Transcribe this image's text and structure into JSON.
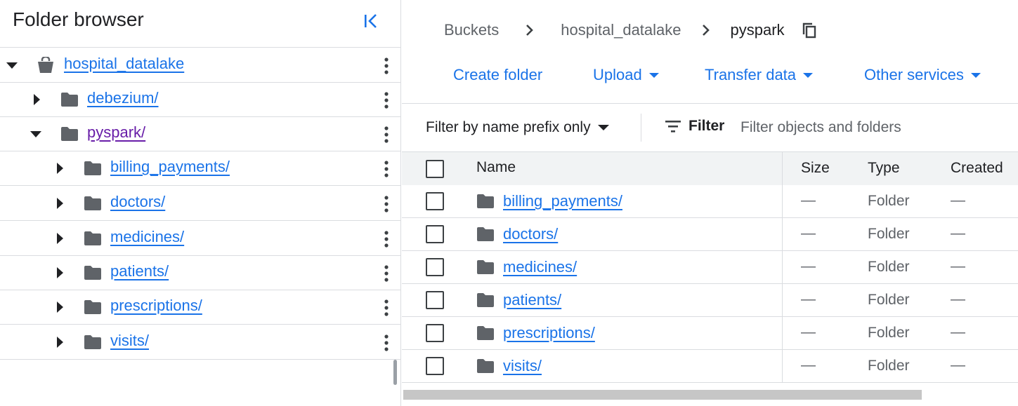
{
  "sidebar": {
    "title": "Folder browser",
    "collapse_icon": "collapse-left-icon",
    "bucket": {
      "label": "hospital_datalake",
      "icon": "bucket-icon",
      "expanded": true
    },
    "items": [
      {
        "label": "debezium/",
        "level": 1,
        "expanded": false,
        "visited": false
      },
      {
        "label": "pyspark/",
        "level": 1,
        "expanded": true,
        "visited": true
      },
      {
        "label": "billing_payments/",
        "level": 2,
        "expanded": false,
        "visited": false
      },
      {
        "label": "doctors/",
        "level": 2,
        "expanded": false,
        "visited": false
      },
      {
        "label": "medicines/",
        "level": 2,
        "expanded": false,
        "visited": false
      },
      {
        "label": "patients/",
        "level": 2,
        "expanded": false,
        "visited": false
      },
      {
        "label": "prescriptions/",
        "level": 2,
        "expanded": false,
        "visited": false
      },
      {
        "label": "visits/",
        "level": 2,
        "expanded": false,
        "visited": false
      }
    ]
  },
  "breadcrumb": {
    "items": [
      "Buckets",
      "hospital_datalake",
      "pyspark"
    ],
    "copy_icon": "copy-icon"
  },
  "actions": {
    "create_folder": "Create folder",
    "upload": "Upload",
    "transfer_data": "Transfer data",
    "other_services": "Other services"
  },
  "filter": {
    "mode": "Filter by name prefix only",
    "button": "Filter",
    "placeholder": "Filter objects and folders"
  },
  "table": {
    "columns": [
      "Name",
      "Size",
      "Type",
      "Created"
    ],
    "rows": [
      {
        "name": "billing_payments/",
        "size": "—",
        "type": "Folder",
        "created": "—"
      },
      {
        "name": "doctors/",
        "size": "—",
        "type": "Folder",
        "created": "—"
      },
      {
        "name": "medicines/",
        "size": "—",
        "type": "Folder",
        "created": "—"
      },
      {
        "name": "patients/",
        "size": "—",
        "type": "Folder",
        "created": "—"
      },
      {
        "name": "prescriptions/",
        "size": "—",
        "type": "Folder",
        "created": "—"
      },
      {
        "name": "visits/",
        "size": "—",
        "type": "Folder",
        "created": "—"
      }
    ]
  },
  "colors": {
    "link": "#1a73e8",
    "visited_link": "#681da8",
    "icon_gray": "#5f6368",
    "border": "#dadce0",
    "header_bg": "#f1f3f4"
  }
}
